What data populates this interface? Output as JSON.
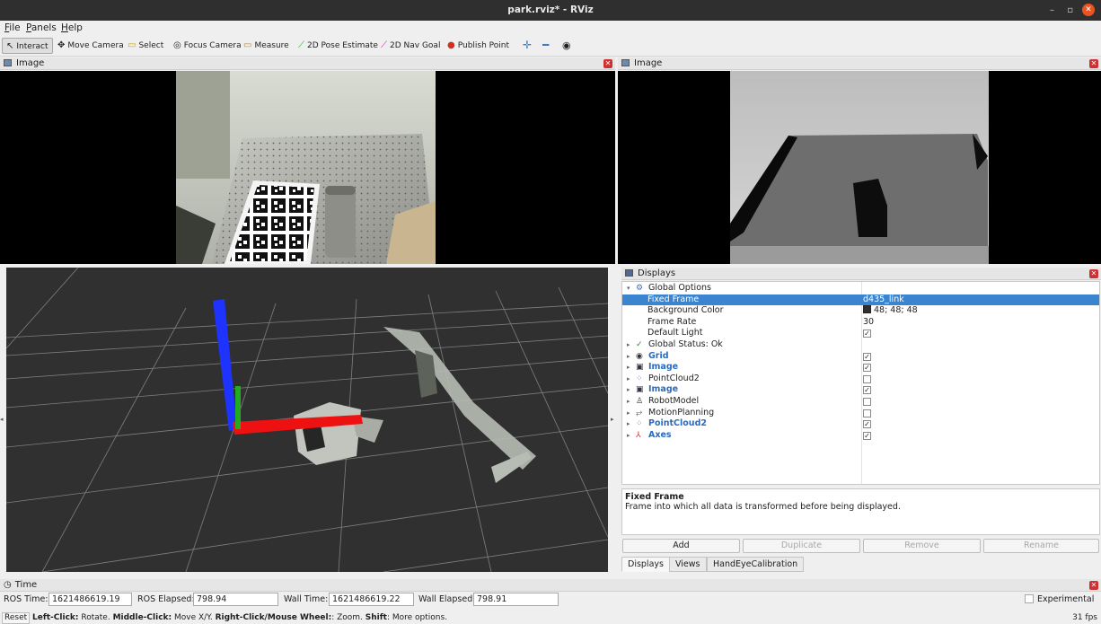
{
  "window": {
    "title": "park.rviz* - RViz",
    "controls": [
      "–",
      "▫",
      "✕"
    ]
  },
  "menu": [
    "File",
    "Panels",
    "Help"
  ],
  "toolbar": [
    {
      "label": "Interact",
      "icon": "cursor-icon",
      "glyph": "↖"
    },
    {
      "label": "Move Camera",
      "icon": "move-camera-icon",
      "glyph": "✥"
    },
    {
      "label": "Select",
      "icon": "select-icon",
      "glyph": "▭"
    },
    {
      "label": "Focus Camera",
      "icon": "focus-camera-icon",
      "glyph": "◎"
    },
    {
      "label": "Measure",
      "icon": "ruler-icon",
      "glyph": "▭"
    },
    {
      "label": "2D Pose Estimate",
      "icon": "pose-arrow-icon",
      "glyph": "⟋"
    },
    {
      "label": "2D Nav Goal",
      "icon": "nav-arrow-icon",
      "glyph": "⟋"
    },
    {
      "label": "Publish Point",
      "icon": "map-pin-icon",
      "glyph": "●"
    }
  ],
  "panels": {
    "image_left": {
      "title": "Image"
    },
    "image_right": {
      "title": "Image"
    },
    "displays": {
      "title": "Displays"
    },
    "time": {
      "title": "Time"
    }
  },
  "displays_tree": [
    {
      "label": "Global Options",
      "value": "",
      "level": 1,
      "expanded": true,
      "icon": "globe-icon",
      "glyph": "⚙",
      "color": "#3a6fb5"
    },
    {
      "label": "Fixed Frame",
      "value": "d435_link",
      "level": 2,
      "selected": true
    },
    {
      "label": "Background Color",
      "value": "48; 48; 48",
      "level": 2,
      "swatch": "#303030"
    },
    {
      "label": "Frame Rate",
      "value": "30",
      "level": 2
    },
    {
      "label": "Default Light",
      "value": "",
      "level": 2,
      "check": true
    },
    {
      "label": "Global Status: Ok",
      "value": "",
      "level": 1,
      "icon": "check-icon",
      "glyph": "✓",
      "color": "#2b8a2b"
    },
    {
      "label": "Grid",
      "value": "",
      "level": 1,
      "bold": true,
      "check": true,
      "icon": "eye-icon",
      "glyph": "◉",
      "color": "#333"
    },
    {
      "label": "Image",
      "value": "",
      "level": 1,
      "bold": true,
      "check": true,
      "icon": "image-icon",
      "glyph": "▣",
      "color": "#334"
    },
    {
      "label": "PointCloud2",
      "value": "",
      "level": 1,
      "check": false,
      "icon": "pointcloud-icon",
      "glyph": "⁘",
      "color": "#3a7fc0"
    },
    {
      "label": "Image",
      "value": "",
      "level": 1,
      "bold": true,
      "check": true,
      "icon": "image-icon",
      "glyph": "▣",
      "color": "#334"
    },
    {
      "label": "RobotModel",
      "value": "",
      "level": 1,
      "check": false,
      "icon": "robot-icon",
      "glyph": "♙",
      "color": "#333"
    },
    {
      "label": "MotionPlanning",
      "value": "",
      "level": 1,
      "check": false,
      "icon": "motion-planning-icon",
      "glyph": "⥂",
      "color": "#7a3ab5"
    },
    {
      "label": "PointCloud2",
      "value": "",
      "level": 1,
      "bold": true,
      "check": true,
      "icon": "pointcloud-icon",
      "glyph": "⁘",
      "color": "#3a7fc0"
    },
    {
      "label": "Axes",
      "value": "",
      "level": 1,
      "bold": true,
      "check": true,
      "icon": "axes-icon",
      "glyph": "⅄",
      "color": "#c03030"
    }
  ],
  "description": {
    "heading": "Fixed Frame",
    "text": "Frame into which all data is transformed before being displayed."
  },
  "buttons": [
    "Add",
    "Duplicate",
    "Remove",
    "Rename"
  ],
  "tabs": [
    "Displays",
    "Views",
    "HandEyeCalibration"
  ],
  "time": {
    "ros_time_label": "ROS Time:",
    "ros_time": "1621486619.19",
    "ros_elapsed_label": "ROS Elapsed:",
    "ros_elapsed": "798.94",
    "wall_time_label": "Wall Time:",
    "wall_time": "1621486619.22",
    "wall_elapsed_label": "Wall Elapsed:",
    "wall_elapsed": "798.91",
    "experimental": "Experimental"
  },
  "status": {
    "reset": "Reset",
    "k1": "Left-Click:",
    "t1": " Rotate. ",
    "k2": "Middle-Click:",
    "t2": " Move X/Y. ",
    "k3": "Right-Click/Mouse Wheel:",
    "t3": ": Zoom. ",
    "k4": "Shift",
    "t4": ": More options.",
    "fps": "31 fps"
  }
}
